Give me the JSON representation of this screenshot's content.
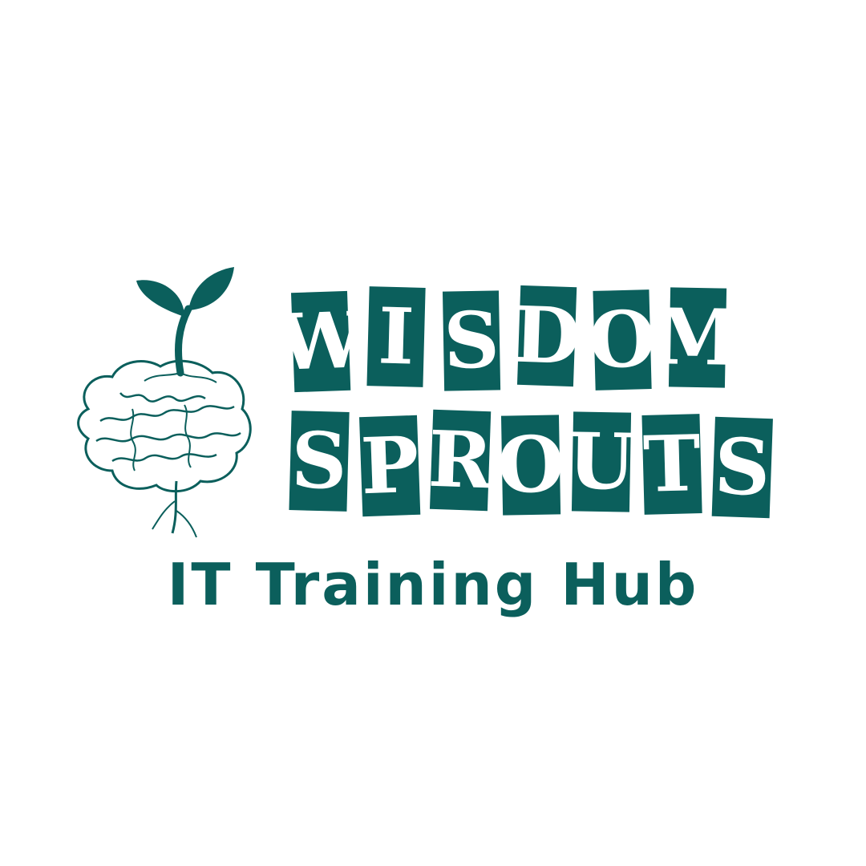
{
  "brand": {
    "line1": [
      "W",
      "I",
      "S",
      "D",
      "O",
      "M"
    ],
    "line2": [
      "S",
      "P",
      "R",
      "O",
      "U",
      "T",
      "S"
    ],
    "tagline": "IT Training Hub"
  },
  "colors": {
    "brand_teal": "#0b5f5c",
    "background": "#ffffff"
  },
  "icons": {
    "logo_mark": "sprouting-brain-icon"
  }
}
